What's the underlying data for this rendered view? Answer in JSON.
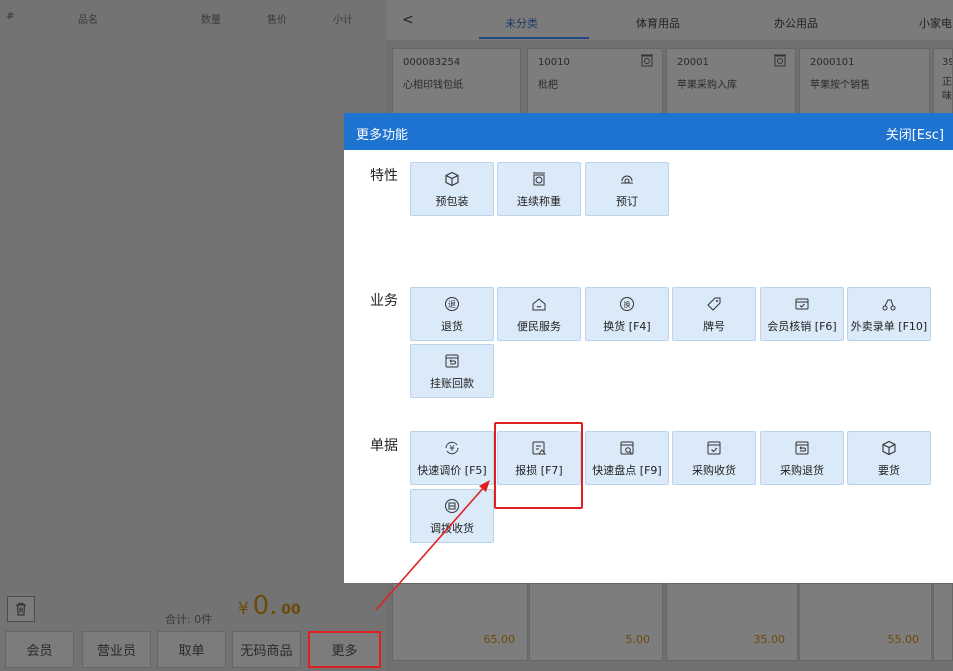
{
  "cart": {
    "headers": [
      "#",
      "品名",
      "数量",
      "售价",
      "小计"
    ],
    "total_label": "合计: 0件",
    "total_currency": "¥",
    "total_int": "0.",
    "total_dec": "00",
    "buttons": [
      "会员",
      "营业员",
      "取单",
      "无码商品",
      "更多"
    ]
  },
  "catalog": {
    "back": "<",
    "tabs": [
      "未分类",
      "体育用品",
      "办公用品",
      "小家电"
    ],
    "products": [
      {
        "code": "000083254",
        "name": "心相印钱包纸"
      },
      {
        "code": "10010",
        "name": "枇杷"
      },
      {
        "code": "20001",
        "name": "苹果采购入库"
      },
      {
        "code": "2000101",
        "name": "苹果按个销售"
      },
      {
        "code": "39",
        "name": "正 味"
      }
    ],
    "prices": [
      "65.00",
      "5.00",
      "35.00",
      "55.00"
    ]
  },
  "modal": {
    "title": "更多功能",
    "close": "关闭[Esc]",
    "sections": {
      "features": {
        "label": "特性",
        "items": [
          "预包装",
          "连续称重",
          "预订"
        ]
      },
      "business": {
        "label": "业务",
        "items": [
          "退货",
          "便民服务",
          "换货 [F4]",
          "牌号",
          "会员核销 [F6]",
          "外卖录单 [F10]",
          "挂账回款"
        ]
      },
      "documents": {
        "label": "单据",
        "items": [
          "快速调价 [F5]",
          "报损 [F7]",
          "快速盘点 [F9]",
          "采购收货",
          "采购退货",
          "要货",
          "调拨收货"
        ]
      }
    }
  },
  "colors": {
    "modal_header": "#1d73cf",
    "tile_bg": "#dbeaf9",
    "annotation": "#e02020",
    "price": "#c8860c"
  }
}
